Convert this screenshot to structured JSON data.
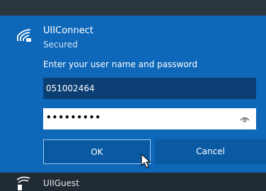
{
  "network": {
    "name": "UIIConnect",
    "status": "Secured",
    "prompt": "Enter your user name and password",
    "username_value": "051002464",
    "password_value": "•••••••••"
  },
  "buttons": {
    "ok": "OK",
    "cancel": "Cancel"
  },
  "next_network": {
    "name": "UIIGuest"
  },
  "icons": {
    "wifi": "wifi-secured-icon",
    "reveal": "eye-icon",
    "cursor": "mouse-pointer-icon",
    "guest": "wifi-shield-icon"
  }
}
